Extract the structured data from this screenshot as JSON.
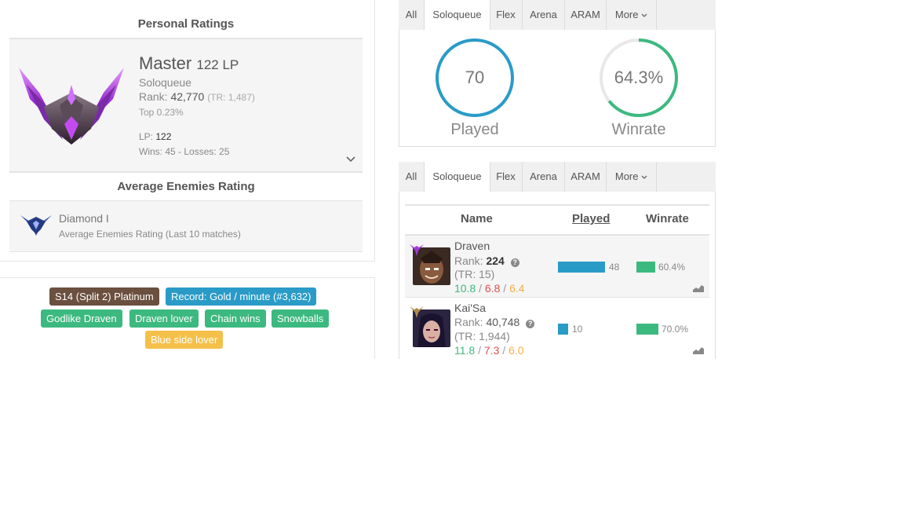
{
  "personal": {
    "header": "Personal Ratings",
    "tier": "Master",
    "lp_label": "122 LP",
    "queue": "Soloqueue",
    "rank_label": "Rank:",
    "rank_value": "42,770",
    "tr": "(TR: 1,487)",
    "top": "Top 0.23%",
    "lp_line_label": "LP:",
    "lp_line_value": "122",
    "record": "Wins: 45 - Losses: 25"
  },
  "enemies": {
    "header": "Average Enemies Rating",
    "tier": "Diamond I",
    "subtitle": "Average Enemies Rating (Last 10 matches)"
  },
  "tags": [
    {
      "label": "S14 (Split 2) Platinum",
      "color": "#6b4f3f"
    },
    {
      "label": "Record: Gold / minute (#3,632)",
      "color": "#2a9bc7"
    },
    {
      "label": "Godlike Draven",
      "color": "#3cb97f"
    },
    {
      "label": "Draven lover",
      "color": "#3cb97f"
    },
    {
      "label": "Chain wins",
      "color": "#3cb97f"
    },
    {
      "label": "Snowballs",
      "color": "#3cb97f"
    },
    {
      "label": "Blue side lover",
      "color": "#f5c04a"
    }
  ],
  "tabs_top": [
    "All",
    "Soloqueue",
    "Flex",
    "Arena",
    "ARAM",
    "More"
  ],
  "tabs_bottom": [
    "All",
    "Soloqueue",
    "Flex",
    "Arena",
    "ARAM",
    "More"
  ],
  "stats": {
    "played_value": "70",
    "played_label": "Played",
    "winrate_value": "64.3%",
    "winrate_label": "Winrate",
    "winrate_fraction": 0.643
  },
  "table": {
    "col_name": "Name",
    "col_played": "Played",
    "col_winrate": "Winrate",
    "rows": [
      {
        "name": "Draven",
        "rank_label": "Rank:",
        "rank": "224",
        "tr": "(TR: 15)",
        "k": "10.8",
        "d": "6.8",
        "a": "6.4",
        "played": "48",
        "played_n": 48,
        "winrate": "60.4%",
        "winrate_f": 0.604
      },
      {
        "name": "Kai'Sa",
        "rank_label": "Rank:",
        "rank": "40,748",
        "tr": "(TR: 1,944)",
        "k": "11.8",
        "d": "7.3",
        "a": "6.0",
        "played": "10",
        "played_n": 10,
        "winrate": "70.0%",
        "winrate_f": 0.7
      }
    ]
  },
  "colors": {
    "kills": "#3cb97f",
    "deaths": "#e05050",
    "assists": "#f5b04a",
    "blue": "#2a9bc7",
    "green": "#3cb97f"
  }
}
